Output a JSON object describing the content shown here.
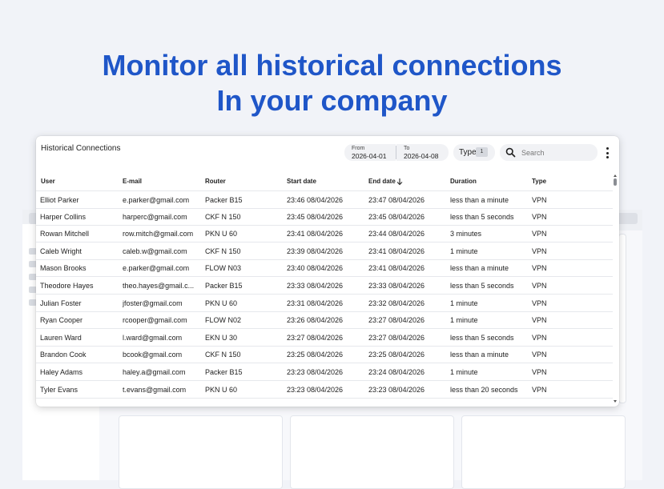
{
  "hero": {
    "line1": "Monitor all historical connections",
    "line2": "In your company"
  },
  "panel": {
    "title": "Historical Connections",
    "from_label": "From",
    "from_value": "2026-04-01",
    "to_label": "To",
    "to_value": "2026-04-08",
    "type_label": "Type",
    "type_count": "1",
    "search_placeholder": "Search",
    "columns": [
      "User",
      "E-mail",
      "Router",
      "Start date",
      "End date",
      "Duration",
      "Type"
    ],
    "sort_icon": "arrow-down-icon",
    "rows": [
      [
        "Elliot Parker",
        "e.parker@gmail.com",
        "Packer B15",
        "23:46 08/04/2026",
        "23:47 08/04/2026",
        "less than a minute",
        "VPN"
      ],
      [
        "Harper Collins",
        "harperc@gmail.com",
        "CKF N 150",
        "23:45 08/04/2026",
        "23:45 08/04/2026",
        "less than 5 seconds",
        "VPN"
      ],
      [
        "Rowan Mitchell",
        "row.mitch@gmail.com",
        "PKN U 60",
        "23:41 08/04/2026",
        "23:44 08/04/2026",
        "3 minutes",
        "VPN"
      ],
      [
        "Caleb Wright",
        "caleb.w@gmail.com",
        "CKF N 150",
        "23:39 08/04/2026",
        "23:41 08/04/2026",
        "1 minute",
        "VPN"
      ],
      [
        "Mason Brooks",
        "e.parker@gmail.com",
        "FLOW N03",
        "23:40 08/04/2026",
        "23:41 08/04/2026",
        "less than a minute",
        "VPN"
      ],
      [
        "Theodore Hayes",
        "theo.hayes@gmail.c...",
        "Packer B15",
        "23:33 08/04/2026",
        "23:33 08/04/2026",
        "less than 5 seconds",
        "VPN"
      ],
      [
        "Julian Foster",
        "jfoster@gmail.com",
        "PKN U 60",
        "23:31 08/04/2026",
        "23:32 08/04/2026",
        "1 minute",
        "VPN"
      ],
      [
        "Ryan Cooper",
        "rcooper@gmail.com",
        "FLOW N02",
        "23:26 08/04/2026",
        "23:27 08/04/2026",
        "1 minute",
        "VPN"
      ],
      [
        "Lauren Ward",
        "l.ward@gmail.com",
        "EKN U 30",
        "23:27 08/04/2026",
        "23:27 08/04/2026",
        "less than 5 seconds",
        "VPN"
      ],
      [
        "Brandon Cook",
        "bcook@gmail.com",
        "CKF N 150",
        "23:25 08/04/2026",
        "23:25 08/04/2026",
        "less than a minute",
        "VPN"
      ],
      [
        "Haley Adams",
        "haley.a@gmail.com",
        "Packer B15",
        "23:23 08/04/2026",
        "23:24 08/04/2026",
        "1 minute",
        "VPN"
      ],
      [
        "Tyler Evans",
        "t.evans@gmail.com",
        "PKN U 60",
        "23:23 08/04/2026",
        "23:23 08/04/2026",
        "less than 20 seconds",
        "VPN"
      ]
    ]
  },
  "colors": {
    "headline": "#1f56c8",
    "background": "#f1f3f8",
    "panel": "#ffffff"
  }
}
